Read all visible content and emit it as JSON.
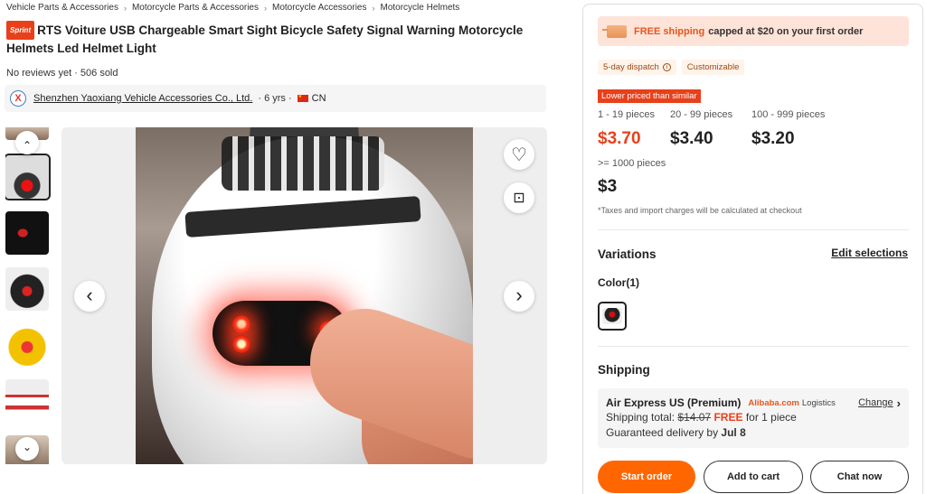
{
  "breadcrumb": [
    "Vehicle Parts & Accessories",
    "Motorcycle Parts & Accessories",
    "Motorcycle Accessories",
    "Motorcycle Helmets"
  ],
  "breadcrumb_sep": "›",
  "product": {
    "badge": "Sprint",
    "title": "RTS Voiture USB Chargeable Smart Sight Bicycle Safety Signal Warning Motorcycle Helmets Led Helmet Light",
    "reviews": "No reviews yet · 506 sold"
  },
  "supplier": {
    "logo_letter": "X",
    "name": "Shenzhen Yaoxiang Vehicle Accessories Co., Ltd.",
    "years": "· 6 yrs ·",
    "country": "CN"
  },
  "gallery": {
    "up_icon": "⌃",
    "down_icon": "⌄",
    "prev_icon": "‹",
    "next_icon": "›",
    "favorite_icon": "♡",
    "visual_search_icon": "⊡"
  },
  "panel": {
    "shipping_banner": {
      "free": "FREE shipping",
      "rest": "capped at $20 on your first order"
    },
    "tags": [
      {
        "label": "5-day dispatch",
        "info": "i"
      },
      {
        "label": "Customizable"
      }
    ],
    "lower_badge": "Lower priced than similar",
    "tiers": [
      {
        "range": "1 - 19 pieces",
        "price": "$3.70"
      },
      {
        "range": "20 - 99 pieces",
        "price": "$3.40"
      },
      {
        "range": "100 - 999 pieces",
        "price": "$3.20"
      },
      {
        "range": ">= 1000 pieces",
        "price": "$3"
      }
    ],
    "tax_note": "*Taxes and import charges will be calculated at checkout",
    "variations_title": "Variations",
    "edit_selections": "Edit selections",
    "color_label": "Color(1)",
    "shipping_title": "Shipping",
    "shipping": {
      "method": "Air Express US (Premium)",
      "provider": "Alibaba.com",
      "logistics": "Logistics",
      "change": "Change",
      "chevron": "›",
      "total_label": "Shipping total:",
      "old_price": "$14.07",
      "free": "FREE",
      "for_qty": "for 1 piece",
      "delivery_label": "Guaranteed delivery by",
      "delivery_date": "Jul 8"
    },
    "buttons": {
      "start_order": "Start order",
      "add_to_cart": "Add to cart",
      "chat_now": "Chat now"
    }
  },
  "colors": {
    "accent": "#ff6600",
    "price_red": "#e8401a",
    "banner_bg": "#fde3d8"
  }
}
